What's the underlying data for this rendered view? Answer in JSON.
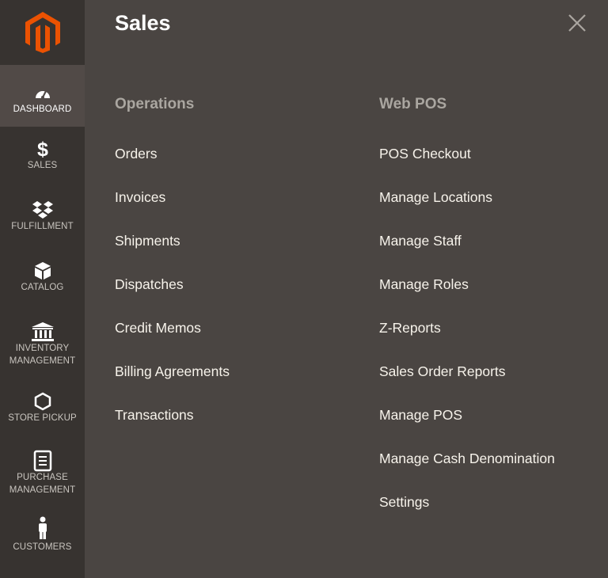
{
  "colors": {
    "sidebar_bg": "#373330",
    "sidebar_active_bg": "#514a47",
    "panel_bg": "#4a4542",
    "brand_orange": "#eb5202",
    "heading_gray": "#aaa6a0",
    "link_white": "#f7f3eb"
  },
  "sidebar": {
    "logo_icon": "magento-logo-icon",
    "items": [
      {
        "label": "DASHBOARD",
        "icon": "dashboard-gauge-icon",
        "active": true
      },
      {
        "label": "SALES",
        "icon": "dollar-icon"
      },
      {
        "label": "FULFILLMENT",
        "icon": "dropbox-icon"
      },
      {
        "label": "CATALOG",
        "icon": "box-icon"
      },
      {
        "label_line1": "INVENTORY",
        "label_line2": "MANAGEMENT",
        "icon": "bank-building-icon"
      },
      {
        "label": "STORE PICKUP",
        "icon": "hexagon-icon"
      },
      {
        "label_line1": "PURCHASE",
        "label_line2": "MANAGEMENT",
        "icon": "document-icon"
      },
      {
        "label": "CUSTOMERS",
        "icon": "person-icon"
      }
    ]
  },
  "panel": {
    "title": "Sales",
    "close_icon": "close-icon",
    "columns": [
      {
        "heading": "Operations",
        "links": [
          "Orders",
          "Invoices",
          "Shipments",
          "Dispatches",
          "Credit Memos",
          "Billing Agreements",
          "Transactions"
        ]
      },
      {
        "heading": "Web POS",
        "links": [
          "POS Checkout",
          "Manage Locations",
          "Manage Staff",
          "Manage Roles",
          "Z-Reports",
          "Sales Order Reports",
          "Manage POS",
          "Manage Cash Denomination",
          "Settings"
        ]
      }
    ]
  }
}
